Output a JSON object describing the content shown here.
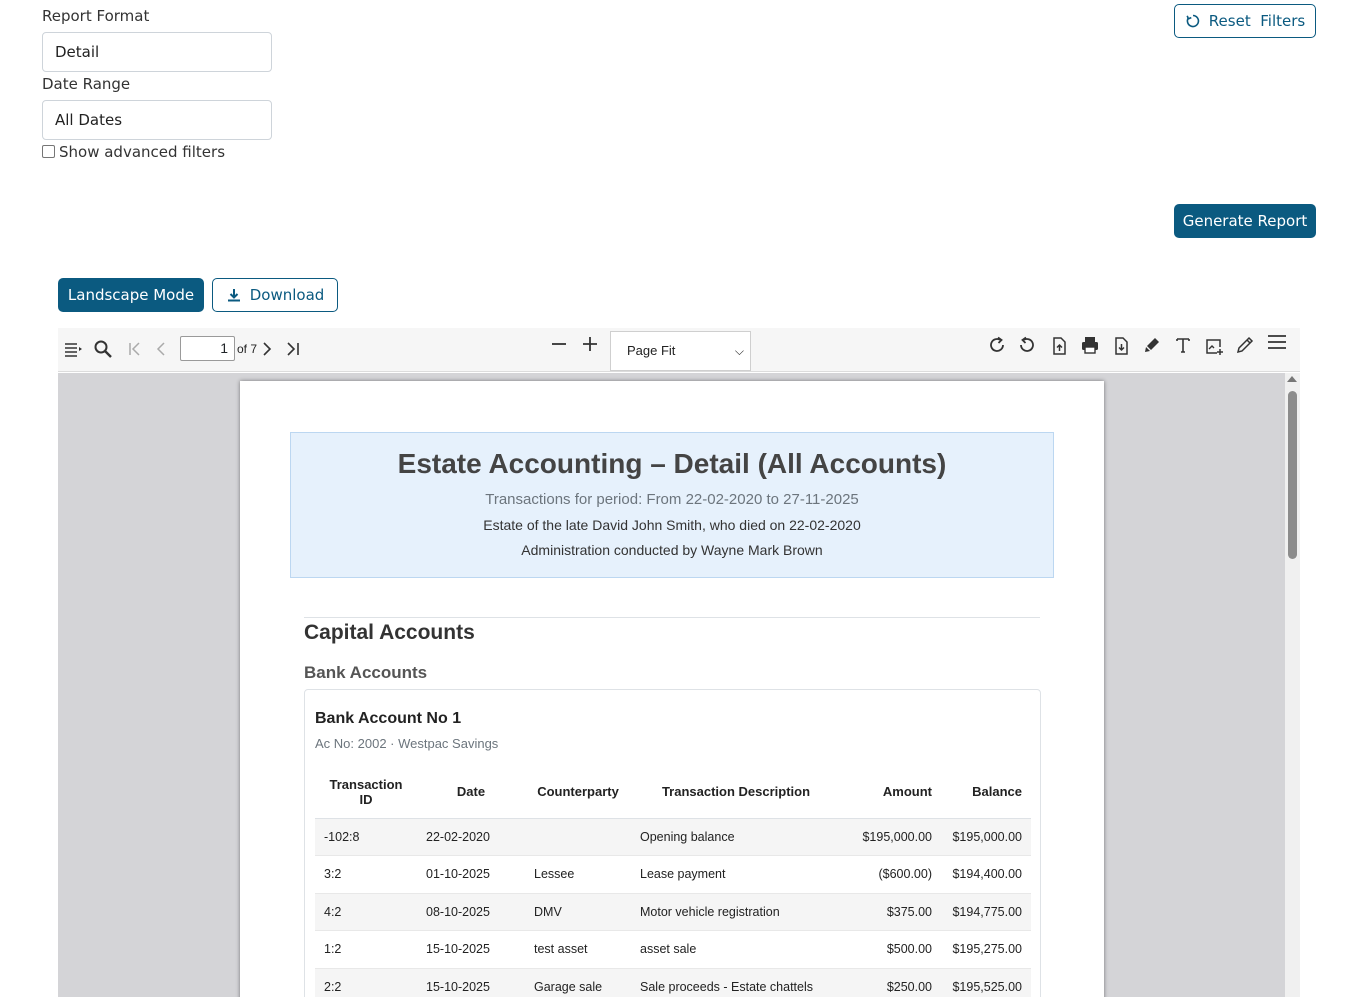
{
  "filters": {
    "report_format_label": "Report Format",
    "report_format_value": "Detail",
    "date_range_label": "Date Range",
    "date_range_value": "All Dates",
    "advanced_filters_label": "Show advanced filters",
    "advanced_filters_checked": false,
    "reset_label": "Reset  Filters",
    "generate_label": "Generate Report"
  },
  "actions": {
    "landscape_label": "Landscape Mode",
    "download_label": "Download"
  },
  "viewer": {
    "page_number": "1",
    "page_total": "of 7",
    "zoom_value": "Page Fit"
  },
  "report": {
    "title": "Estate Accounting – Detail (All Accounts)",
    "period": "Transactions for period: From 22-02-2020 to 27-11-2025",
    "estate_line": "Estate of the late David John Smith, who died on 22-02-2020",
    "admin_line": "Administration conducted by Wayne Mark Brown",
    "section_title": "Capital Accounts",
    "subsection_title": "Bank Accounts",
    "account": {
      "name": "Bank Account No 1",
      "details": "Ac No: 2002 · Westpac Savings"
    },
    "table": {
      "headers": [
        "Transaction ID",
        "Date",
        "Counterparty",
        "Transaction Description",
        "Amount",
        "Balance"
      ],
      "rows": [
        [
          "-102:8",
          "22-02-2020",
          "",
          "Opening balance",
          "$195,000.00",
          "$195,000.00"
        ],
        [
          "3:2",
          "01-10-2025",
          "Lessee",
          "Lease payment",
          "($600.00)",
          "$194,400.00"
        ],
        [
          "4:2",
          "08-10-2025",
          "DMV",
          "Motor vehicle registration",
          "$375.00",
          "$194,775.00"
        ],
        [
          "1:2",
          "15-10-2025",
          "test asset",
          "asset sale",
          "$500.00",
          "$195,275.00"
        ],
        [
          "2:2",
          "15-10-2025",
          "Garage sale",
          "Sale proceeds - Estate chattels",
          "$250.00",
          "$195,525.00"
        ]
      ]
    }
  },
  "colors": {
    "primary": "#0b5a80",
    "header_bg": "#e6f1fc"
  }
}
